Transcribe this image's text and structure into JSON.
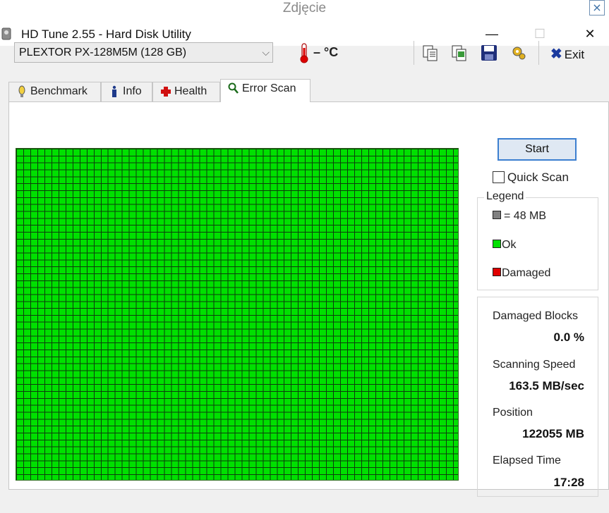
{
  "viewer": {
    "title": "Zdjęcie",
    "close": "×"
  },
  "window": {
    "title": "HD Tune 2.55 - Hard Disk Utility",
    "minimize": "—",
    "maximize": "☐",
    "close": "✕"
  },
  "toolbar": {
    "drive": "PLEXTOR PX-128M5M (128 GB)",
    "temperature": "– °C",
    "exit_label": "Exit"
  },
  "tabs": [
    {
      "label": "Benchmark",
      "icon": "stopwatch-icon"
    },
    {
      "label": "Info",
      "icon": "info-icon"
    },
    {
      "label": "Health",
      "icon": "health-cross-icon"
    },
    {
      "label": "Error Scan",
      "icon": "magnifier-icon",
      "active": true
    }
  ],
  "scan": {
    "start_label": "Start",
    "quick_scan_label": "Quick Scan",
    "quick_scan_checked": false,
    "legend_title": "Legend",
    "legend": [
      {
        "label": "= 48 MB",
        "color": "#808080"
      },
      {
        "label": "Ok",
        "color": "#00e000"
      },
      {
        "label": "Damaged",
        "color": "#e00000"
      }
    ],
    "stats": [
      {
        "label": "Damaged Blocks",
        "value": "0.0 %"
      },
      {
        "label": "Scanning Speed",
        "value": "163.5 MB/sec"
      },
      {
        "label": "Position",
        "value": "122055 MB"
      },
      {
        "label": "Elapsed Time",
        "value": "17:28"
      }
    ]
  },
  "colors": {
    "ok": "#00e000",
    "damaged": "#e00000",
    "accent": "#3c7fd0"
  }
}
